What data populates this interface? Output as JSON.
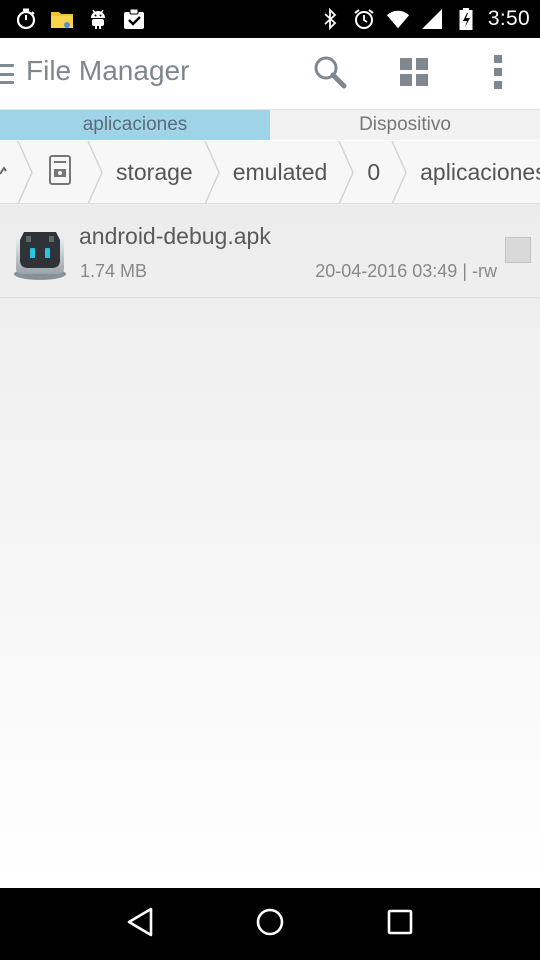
{
  "status_bar": {
    "time": "3:50",
    "left_icons": [
      "stopwatch-icon",
      "folder-icon",
      "android-icon",
      "clipboard-check-icon"
    ],
    "right_icons": [
      "bluetooth-icon",
      "alarm-icon",
      "wifi-icon",
      "signal-icon",
      "battery-icon"
    ]
  },
  "app_bar": {
    "title": "File Manager",
    "actions": [
      "search-icon",
      "grid-view-icon",
      "overflow-menu-icon"
    ]
  },
  "tabs": [
    {
      "label": "aplicaciones",
      "active": true
    },
    {
      "label": "Dispositivo",
      "active": false
    }
  ],
  "breadcrumb": {
    "items": [
      "storage",
      "emulated",
      "0",
      "aplicaciones"
    ]
  },
  "files": [
    {
      "name": "android-debug.apk",
      "size": "1.74 MB",
      "meta": "20-04-2016 03:49 | -rw",
      "icon": "apk-app-icon",
      "checked": false
    }
  ],
  "nav_bar": {
    "buttons": [
      "back-icon",
      "home-icon",
      "recents-icon"
    ]
  },
  "colors": {
    "active_tab": "#9fd3e8",
    "title": "#7d8790"
  }
}
